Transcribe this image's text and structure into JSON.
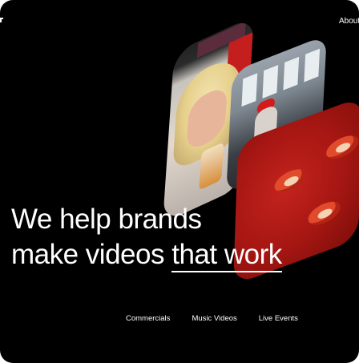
{
  "nav": {
    "about_label": "About"
  },
  "hero": {
    "line1": "We help brands",
    "line2_plain": "make videos",
    "line2_highlight": "that work"
  },
  "categories": [
    "Commercials",
    "Music Videos",
    "Live Events"
  ],
  "colors": {
    "background": "#000000",
    "text": "#ffffff",
    "accent_red": "#c41e1e"
  }
}
